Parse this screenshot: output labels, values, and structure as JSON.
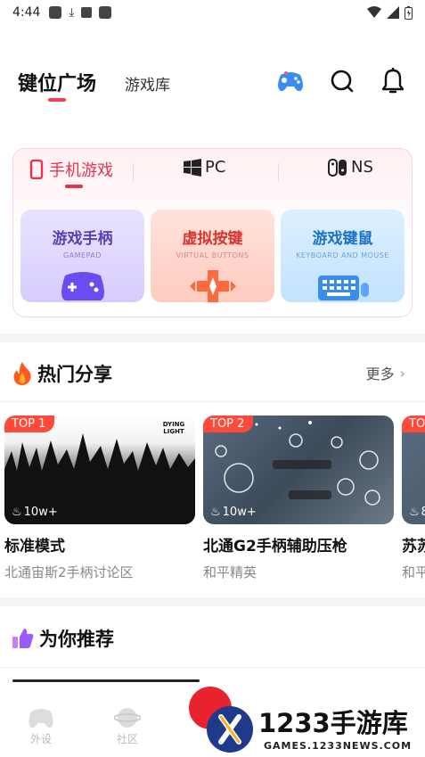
{
  "status": {
    "time": "4:44"
  },
  "header": {
    "tabs": [
      "键位广场",
      "游戏库"
    ]
  },
  "categories": {
    "tabs": [
      "手机游戏",
      "PC",
      "NS"
    ],
    "tiles": [
      {
        "title": "游戏手柄",
        "subtitle": "GAMEPAD",
        "color": "#5b3fb0"
      },
      {
        "title": "虚拟按键",
        "subtitle": "VIRTUAL BUTTONS",
        "color": "#d8352f"
      },
      {
        "title": "游戏键鼠",
        "subtitle": "KEYBOARD AND MOUSE",
        "color": "#1a73c7"
      }
    ]
  },
  "hot": {
    "title": "热门分享",
    "more": "更多",
    "cards": [
      {
        "badge": "TOP 1",
        "views": "10w+",
        "title": "标准模式",
        "subtitle": "北通宙斯2手柄讨论区",
        "logo": "DYING LIGHT"
      },
      {
        "badge": "TOP 2",
        "views": "10w+",
        "title": "北通G2手柄辅助压枪",
        "subtitle": "和平精英"
      },
      {
        "badge": "TOP",
        "views": "8",
        "title": "苏苏",
        "subtitle": "和平"
      }
    ]
  },
  "recommend": {
    "title": "为你推荐"
  },
  "nav": [
    "外设",
    "社区"
  ],
  "watermark": {
    "brand": "1233手游库",
    "url": "GAMES.1233NEWS.COM"
  }
}
